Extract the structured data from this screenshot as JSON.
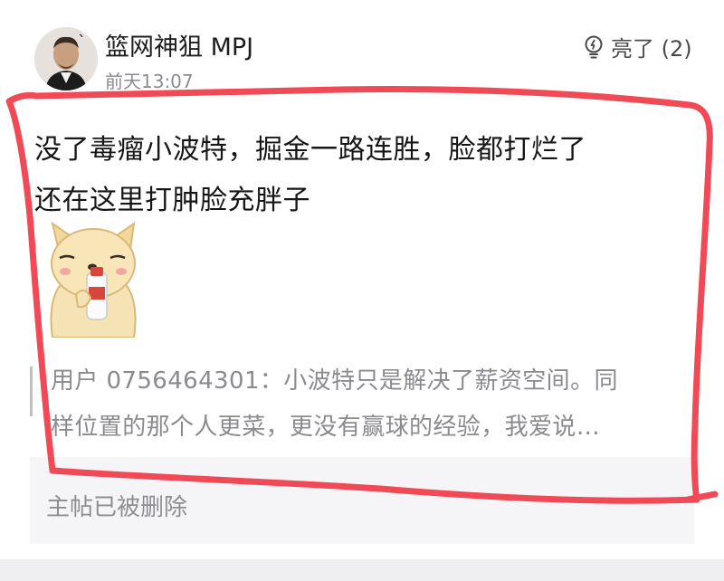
{
  "post": {
    "username": "篮网神狙 MPJ",
    "tick": "`",
    "timestamp": "前天13:07",
    "light_label": "亮了 (2)",
    "content_line1": "没了毒瘤小波特，掘金一路连胜，脸都打烂了",
    "content_line2": "还在这里打肿脸充胖子"
  },
  "quote": {
    "line1": "用户 0756464301：小波特只是解决了薪资空间。同",
    "line2": "样位置的那个人更菜，更没有赢球的经验，我爱说…"
  },
  "parent": {
    "deleted_notice": "主帖已被删除"
  },
  "colors": {
    "annotation_red": "#f04a57",
    "text_primary": "#161616",
    "text_secondary": "#8a8a8f"
  },
  "icons": {
    "light": "lightbulb-icon",
    "sticker": "dog-drinking-sticker"
  }
}
